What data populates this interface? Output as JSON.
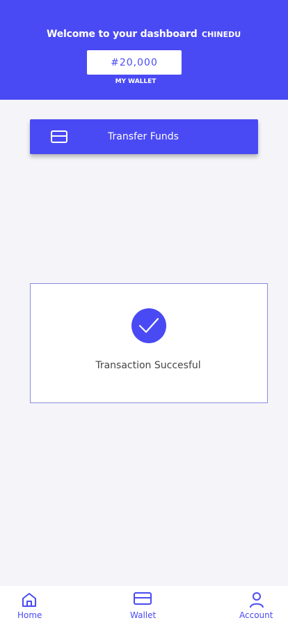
{
  "header": {
    "welcome_text": "Welcome to your dashboard",
    "username": "CHINEDU",
    "wallet_balance": "#20,000",
    "wallet_label": "MY WALLET"
  },
  "transfer": {
    "label": "Transfer Funds",
    "icon": "card-icon"
  },
  "success": {
    "icon": "check-icon",
    "message": "Transaction Succesful"
  },
  "bottom_nav": {
    "items": [
      {
        "label": "Home",
        "icon": "home-icon"
      },
      {
        "label": "Wallet",
        "icon": "wallet-icon"
      },
      {
        "label": "Account",
        "icon": "user-icon"
      }
    ]
  },
  "colors": {
    "primary": "#4a4af4",
    "background": "#f5f5f9",
    "card_border": "#8a8ae0"
  }
}
